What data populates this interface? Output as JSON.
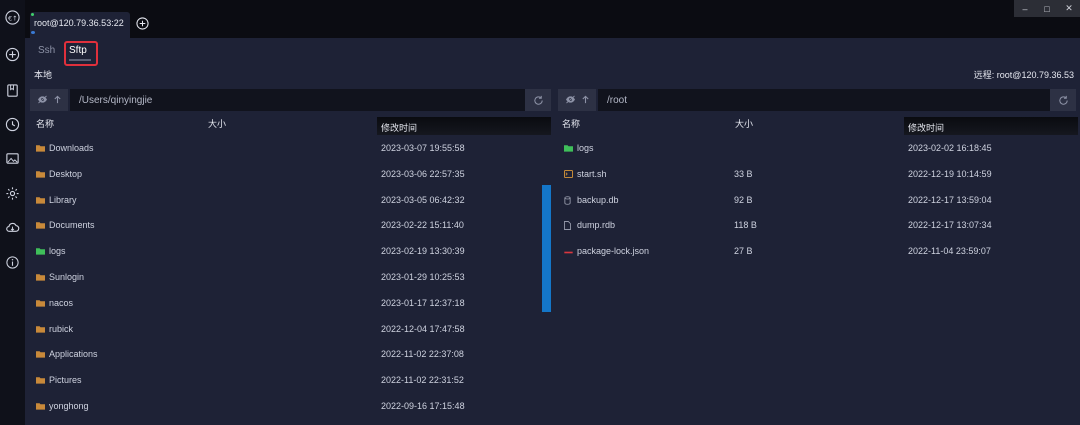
{
  "tab": {
    "label": "root@120.79.36.53:22"
  },
  "window_controls": {
    "minimize": "–",
    "maximize": "□",
    "close": "✕"
  },
  "subtabs": {
    "ssh": "Ssh",
    "sftp": "Sftp"
  },
  "local": {
    "title": "本地",
    "path": "/Users/qinyingjie",
    "headers": {
      "name": "名称",
      "size": "大小",
      "time": "修改时间"
    },
    "rows": [
      {
        "name": "Downloads",
        "icon": "folder-icon",
        "size": "",
        "time": "2023-03-07 19:55:58"
      },
      {
        "name": "Desktop",
        "icon": "folder-icon",
        "size": "",
        "time": "2023-03-06 22:57:35"
      },
      {
        "name": "Library",
        "icon": "folder-icon",
        "size": "",
        "time": "2023-03-05 06:42:32"
      },
      {
        "name": "Documents",
        "icon": "folder-icon",
        "size": "",
        "time": "2023-02-22 15:11:40"
      },
      {
        "name": "logs",
        "icon": "green-folder-icon",
        "size": "",
        "time": "2023-02-19 13:30:39"
      },
      {
        "name": "Sunlogin",
        "icon": "folder-icon",
        "size": "",
        "time": "2023-01-29 10:25:53"
      },
      {
        "name": "nacos",
        "icon": "folder-icon",
        "size": "",
        "time": "2023-01-17 12:37:18"
      },
      {
        "name": "rubick",
        "icon": "folder-icon",
        "size": "",
        "time": "2022-12-04 17:47:58"
      },
      {
        "name": "Applications",
        "icon": "folder-icon",
        "size": "",
        "time": "2022-11-02 22:37:08"
      },
      {
        "name": "Pictures",
        "icon": "folder-icon",
        "size": "",
        "time": "2022-11-02 22:31:52"
      },
      {
        "name": "yonghong",
        "icon": "folder-icon",
        "size": "",
        "time": "2022-09-16 17:15:48"
      }
    ]
  },
  "remote": {
    "title": "远程: root@120.79.36.53",
    "path": "/root",
    "headers": {
      "name": "名称",
      "size": "大小",
      "time": "修改时间"
    },
    "rows": [
      {
        "name": "logs",
        "icon": "green-folder-icon",
        "size": "",
        "time": "2023-02-02 16:18:45"
      },
      {
        "name": "start.sh",
        "icon": "script-file-icon",
        "size": "33 B",
        "time": "2022-12-19 10:14:59"
      },
      {
        "name": "backup.db",
        "icon": "database-file-icon",
        "size": "92 B",
        "time": "2022-12-17 13:59:04"
      },
      {
        "name": "dump.rdb",
        "icon": "file-icon",
        "size": "118 B",
        "time": "2022-12-17 13:07:34"
      },
      {
        "name": "package-lock.json",
        "icon": "json-file-icon",
        "size": "27 B",
        "time": "2022-11-04 23:59:07"
      }
    ]
  },
  "colors": {
    "accent": "#1476c8",
    "highlight": "#e0303c",
    "folder": "#c8893a",
    "green_folder": "#3fbf5a"
  }
}
